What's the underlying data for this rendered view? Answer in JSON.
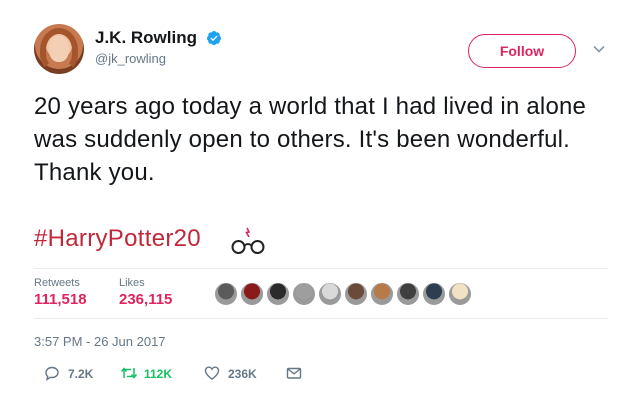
{
  "author": {
    "name": "J.K. Rowling",
    "handle": "@jk_rowling",
    "verified": true,
    "avatar_icon": "avatar-photo"
  },
  "follow_button_label": "Follow",
  "tweet": {
    "text": "20 years ago today a world that I had lived in alone was suddenly open to others. It's been wonderful. Thank you.",
    "hashtag": "#HarryPotter20",
    "hashtag_icon": "harry-potter-glasses-icon"
  },
  "stats": {
    "retweets_label": "Retweets",
    "retweets_value": "111,518",
    "likes_label": "Likes",
    "likes_value": "236,115"
  },
  "liker_avatars": [
    {
      "color": "#5b5b5b"
    },
    {
      "color": "#8b1a1a"
    },
    {
      "color": "#2b2b2b"
    },
    {
      "color": "#9e9e9e"
    },
    {
      "color": "#d9d9d9"
    },
    {
      "color": "#6b4a3a"
    },
    {
      "color": "#b97a4a"
    },
    {
      "color": "#3f3f3f"
    },
    {
      "color": "#2c3e50"
    },
    {
      "color": "#f2e2c4"
    }
  ],
  "timestamp": "3:57 PM - 26 Jun 2017",
  "actions": {
    "reply_count": "7.2K",
    "retweet_count": "112K",
    "like_count": "236K"
  },
  "colors": {
    "accent": "#e0245e",
    "retweet_green": "#17bf63",
    "muted": "#657786",
    "verified_blue": "#1da1f2",
    "hashtag": "#c0283a"
  }
}
